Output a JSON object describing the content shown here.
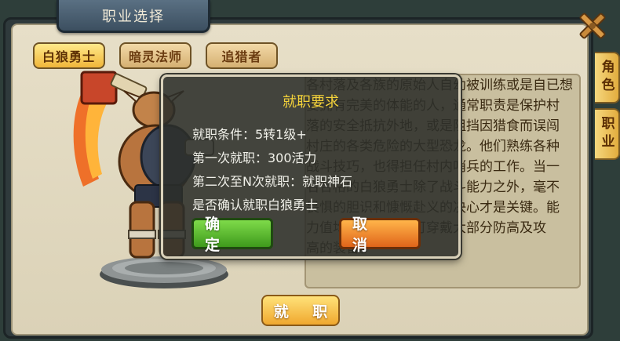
{
  "window": {
    "title": "职业选择"
  },
  "class_tabs": [
    {
      "label": "白狼勇士",
      "active": true
    },
    {
      "label": "暗灵法师",
      "active": false
    },
    {
      "label": "追猎者",
      "active": false
    }
  ],
  "side_tabs": [
    {
      "label": "角色"
    },
    {
      "label": "职业"
    }
  ],
  "description": {
    "lines": [
      "各村落及各族的原始人自幼被训练或是自已想",
      "要拥有完美的体能的人，通常职责是保护村",
      "落的安全抵抗外地，或是阻挡因猎食而误闯",
      "村庄的各类危险的大型恐龙。他们熟练各种",
      "战斗技巧，也得担任村内哨兵的工作。当一",
      "名合格的白狼勇士除了战斗能力之外，毫不",
      "畏惧的胆识和慷慨赴义的决心才是关键。能",
      "力值均衡的职业，可穿戴大部分防高及攻",
      "高的装备。"
    ]
  },
  "dialog": {
    "title": "就职要求",
    "condition": "就职条件：5转1级+",
    "first_time": "第一次就职：300活力",
    "nth_time": "第二次至N次就职：就职神石",
    "confirm_question": "是否确认就职白狼勇士",
    "confirm_label": "确 定",
    "cancel_label": "取 消"
  },
  "take_job_label": "就 职",
  "colors": {
    "accent_gold": "#f4d23a",
    "confirm_green": "#3e9a1c",
    "cancel_orange": "#e0641a",
    "panel_bg": "#e7dfc8"
  },
  "icons": {
    "close": "close-x-icon",
    "hero": "white-wolf-warrior-character"
  }
}
